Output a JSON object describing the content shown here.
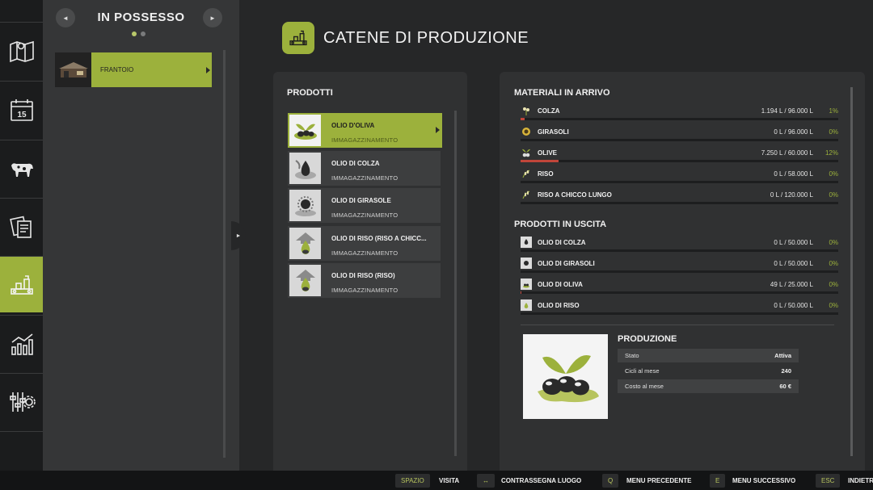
{
  "sidebar": {
    "items": [
      {
        "icon": "map-icon"
      },
      {
        "icon": "calendar-icon",
        "text": "15"
      },
      {
        "icon": "livestock-icon"
      },
      {
        "icon": "contracts-icon"
      },
      {
        "icon": "production-icon",
        "active": true
      },
      {
        "icon": "statistics-icon"
      },
      {
        "icon": "settings-icon"
      }
    ]
  },
  "owned": {
    "title": "IN POSSESSO",
    "prev_symbol": "◄",
    "next_symbol": "►",
    "farm": {
      "label": "FRANTOIO"
    },
    "collapse_symbol": "►"
  },
  "header": {
    "title": "CATENE DI PRODUZIONE"
  },
  "products": {
    "label": "PRODOTTI",
    "items": [
      {
        "name": "OLIO D'OLIVA",
        "sub": "IMMAGAZZINAMENTO",
        "active": true
      },
      {
        "name": "OLIO DI COLZA",
        "sub": "IMMAGAZZINAMENTO"
      },
      {
        "name": "OLIO DI GIRASOLE",
        "sub": "IMMAGAZZINAMENTO"
      },
      {
        "name": "OLIO DI RISO (RISO A CHICC...",
        "sub": "IMMAGAZZINAMENTO"
      },
      {
        "name": "OLIO DI RISO (RISO)",
        "sub": "IMMAGAZZINAMENTO"
      }
    ]
  },
  "incoming": {
    "label": "MATERIALI IN ARRIVO",
    "rows": [
      {
        "name": "COLZA",
        "amount": "1.194 L / 96.000 L",
        "pct": "1%",
        "fill": 0.012
      },
      {
        "name": "GIRASOLI",
        "amount": "0 L / 96.000 L",
        "pct": "0%",
        "fill": 0
      },
      {
        "name": "OLIVE",
        "amount": "7.250 L / 60.000 L",
        "pct": "12%",
        "fill": 0.12
      },
      {
        "name": "RISO",
        "amount": "0 L / 58.000 L",
        "pct": "0%",
        "fill": 0
      },
      {
        "name": "RISO A CHICCO LUNGO",
        "amount": "0 L / 120.000 L",
        "pct": "0%",
        "fill": 0
      }
    ]
  },
  "outgoing": {
    "label": "PRODOTTI IN USCITA",
    "rows": [
      {
        "name": "OLIO DI COLZA",
        "amount": "0 L / 50.000 L",
        "pct": "0%",
        "fill": 0
      },
      {
        "name": "OLIO DI GIRASOLI",
        "amount": "0 L / 50.000 L",
        "pct": "0%",
        "fill": 0
      },
      {
        "name": "OLIO DI OLIVA",
        "amount": "49 L / 25.000 L",
        "pct": "0%",
        "fill": 0.002
      },
      {
        "name": "OLIO DI RISO",
        "amount": "0 L / 50.000 L",
        "pct": "0%",
        "fill": 0
      }
    ]
  },
  "production": {
    "label": "PRODUZIONE",
    "stats": [
      {
        "key": "Stato",
        "value": "Attiva"
      },
      {
        "key": "Cicli al mese",
        "value": "240"
      },
      {
        "key": "Costo al mese",
        "value": "60 €"
      }
    ]
  },
  "footer": {
    "actions": [
      {
        "key": "SPAZIO",
        "label": "VISITA"
      },
      {
        "key": "↔",
        "label": "CONTRASSEGNA LUOGO"
      },
      {
        "key": "Q",
        "label": "MENU PRECEDENTE"
      },
      {
        "key": "E",
        "label": "MENU SUCCESSIVO"
      },
      {
        "key": "ESC",
        "label": "INDIETRO"
      }
    ]
  },
  "colors": {
    "accent": "#9cb13c",
    "bar_fill": "#c0453a",
    "panel": "#303132"
  }
}
